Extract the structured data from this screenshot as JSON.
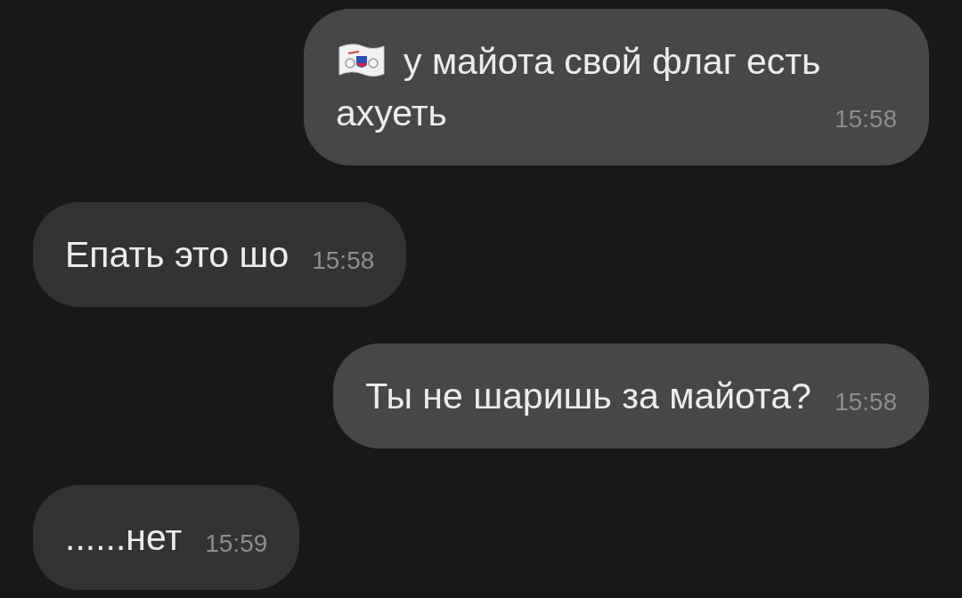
{
  "messages": [
    {
      "kind": "outgoing",
      "leading_emoji": true,
      "text": "у майота свой флаг есть ахуеть",
      "time": "15:58"
    },
    {
      "kind": "incoming",
      "leading_emoji": false,
      "text": "Епать это шо",
      "time": "15:58"
    },
    {
      "kind": "outgoing",
      "leading_emoji": false,
      "text": "Ты не шаришь за майота?",
      "time": "15:58"
    },
    {
      "kind": "incoming",
      "leading_emoji": false,
      "text": "......нет",
      "time": "15:59"
    }
  ]
}
